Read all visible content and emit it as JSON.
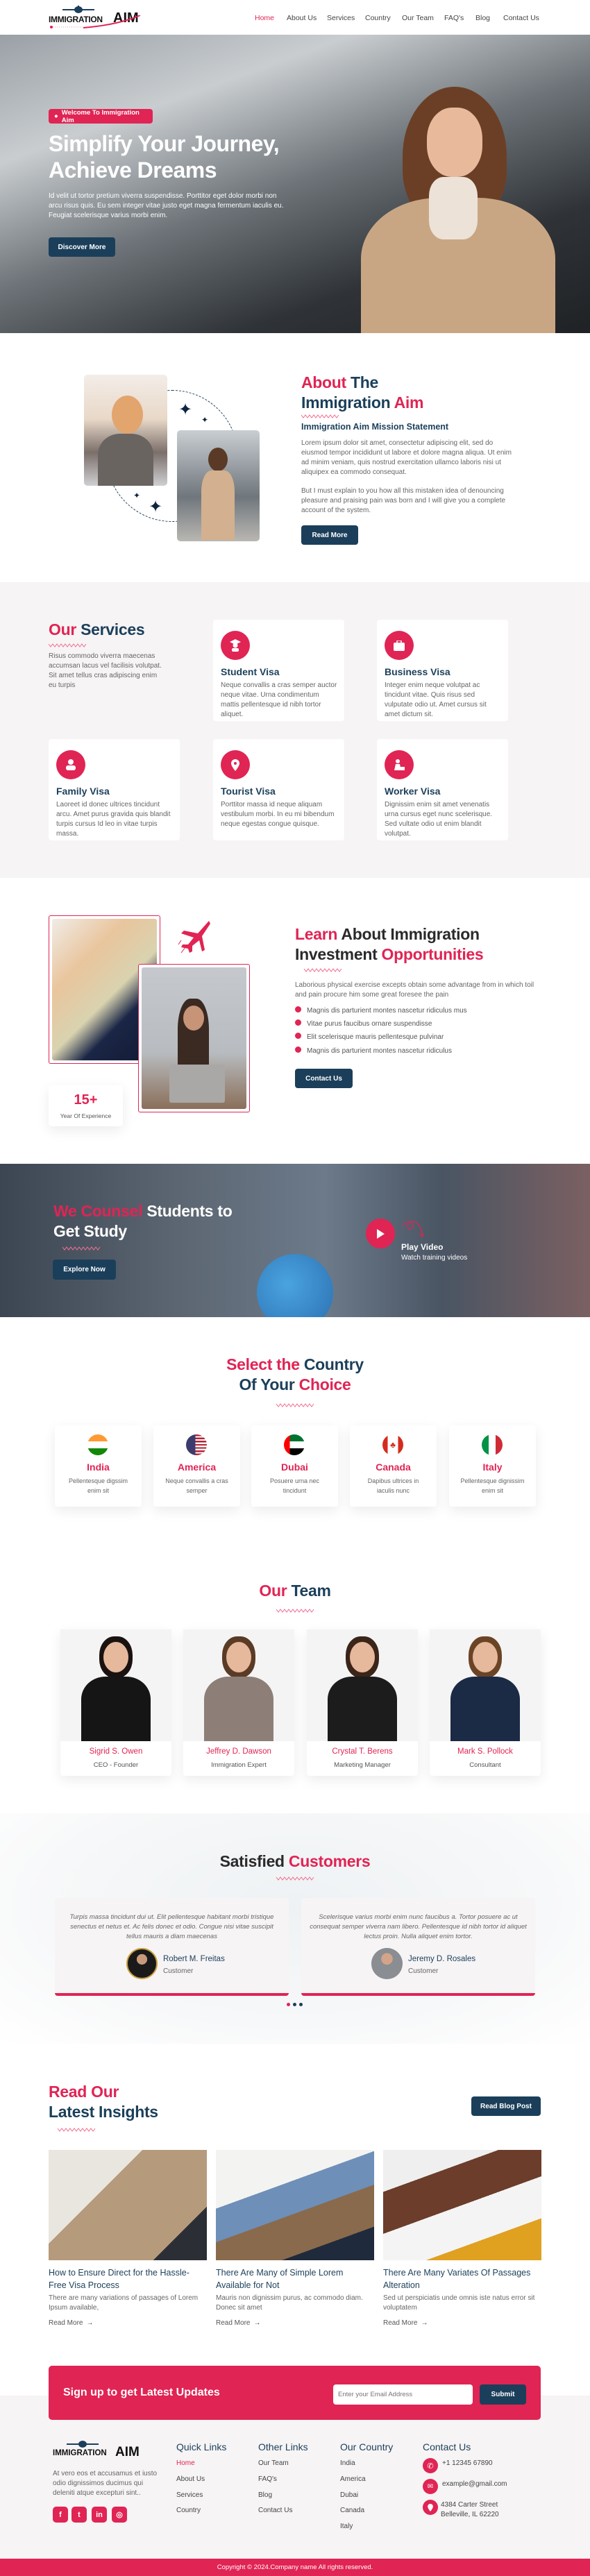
{
  "colors": {
    "accent": "#e02454",
    "primary": "#1b3f5a",
    "section_bg": "#f6f4f5"
  },
  "nav": {
    "logo_text": "IMMIGRATION",
    "logo_accent": "AIM",
    "items": [
      "Home",
      "About Us",
      "Services",
      "Country",
      "Our Team",
      "FAQ's",
      "Blog",
      "Contact Us"
    ],
    "active": "Home"
  },
  "hero": {
    "badge": "Welcome To Immigration Aim",
    "title_line1": "Simplify Your Journey,",
    "title_line2": "Achieve Dreams",
    "paragraph": "Id velit ut tortor pretium viverra suspendisse. Porttitor eget dolor morbi non arcu risus quis. Eu sem integer vitae justo eget magna fermentum iaculis eu. Feugiat scelerisque varius morbi enim.",
    "button": "Discover More"
  },
  "about": {
    "h_accent1": "About",
    "h_1": "The",
    "h_2": "Immigration",
    "h_accent2": "Aim",
    "subtitle": "Immigration Aim Mission Statement",
    "paragraphs": [
      "Lorem ipsum dolor sit amet, consectetur adipiscing elit, sed do eiusmod tempor incididunt ut labore et dolore magna aliqua. Ut enim ad minim veniam, quis nostrud exercitation ullamco laboris nisi ut aliquipex ea commodo consequat.",
      "But I must explain to you how all this mistaken idea of denouncing pleasure and praising pain was born and I will give you a complete account of the system."
    ],
    "button": "Read More"
  },
  "services": {
    "h_accent": "Our",
    "h_rest": "Services",
    "description": "Risus commodo viverra maecenas accumsan lacus vel facilisis volutpat. Sit amet tellus cras adipiscing enim eu turpis",
    "items": [
      {
        "title": "Student Visa",
        "desc": "Neque convallis a cras semper auctor neque vitae. Urna condimentum mattis pellentesque id nibh tortor aliquet.",
        "icon": "graduate-icon"
      },
      {
        "title": "Business Visa",
        "desc": "Integer enim neque volutpat ac tincidunt vitae. Quis risus sed vulputate odio ut. Amet cursus sit amet dictum sit.",
        "icon": "briefcase-icon"
      },
      {
        "title": "Family Visa",
        "desc": "Laoreet id donec ultrices tincidunt arcu. Amet purus gravida quis blandit turpis cursus Id leo in vitae turpis massa.",
        "icon": "user-icon"
      },
      {
        "title": "Tourist Visa",
        "desc": "Porttitor massa id neque aliquam vestibulum morbi. In eu mi bibendum neque egestas congue quisque.",
        "icon": "map-pin-icon"
      },
      {
        "title": "Worker Visa",
        "desc": "Dignissim enim sit amet venenatis urna cursus eget nunc scelerisque. Sed vultate odio ut enim blandit volutpat.",
        "icon": "worker-icon"
      }
    ]
  },
  "learn": {
    "h_accent1": "Learn",
    "h_1": "About Immigration",
    "h_2": "Investment",
    "h_accent2": "Opportunities",
    "paragraph": "Laborious physical exercise excepts obtain some advantage from in which toil and pain procure him some great foresee the pain",
    "list": [
      "Magnis dis parturient montes nascetur ridiculus mus",
      "Vitae purus faucibus ornare suspendisse",
      "Elit scelerisque mauris pellentesque pulvinar",
      "Magnis dis parturient montes nascetur ridiculus"
    ],
    "button": "Contact Us",
    "stat_value": "15+",
    "stat_label": "Year Of Experience"
  },
  "counsel": {
    "h_accent": "We Counsel",
    "h_1": "Students to",
    "h_2": "Get Study",
    "button": "Explore Now",
    "play_title": "Play Video",
    "play_sub": "Watch training videos"
  },
  "countries": {
    "h_accent1": "Select the",
    "h_1": "Country",
    "h_2": "Of Your",
    "h_accent2": "Choice",
    "items": [
      {
        "name": "India",
        "desc": "Pellentesque digssim enim sit"
      },
      {
        "name": "America",
        "desc": "Neque convallis a cras semper"
      },
      {
        "name": "Dubai",
        "desc": "Posuere urna nec tincidunt"
      },
      {
        "name": "Canada",
        "desc": "Dapibus ultrices in iaculis nunc"
      },
      {
        "name": "Italy",
        "desc": "Pellentesque dignissim enim sit"
      }
    ]
  },
  "team": {
    "h_accent": "Our",
    "h_rest": "Team",
    "members": [
      {
        "name": "Sigrid S. Owen",
        "role": "CEO - Founder"
      },
      {
        "name": "Jeffrey D. Dawson",
        "role": "Immigration Expert"
      },
      {
        "name": "Crystal T. Berens",
        "role": "Marketing Manager"
      },
      {
        "name": "Mark S. Pollock",
        "role": "Consultant"
      }
    ]
  },
  "testimonials": {
    "h_1": "Satisfied",
    "h_accent": "Customers",
    "items": [
      {
        "text": "Turpis massa tincidunt dui ut. Elit pellentesque habitant morbi tristique senectus et netus et. Ac felis donec et odio. Congue nisi vitae suscipit tellus mauris a diam maecenas",
        "name": "Robert M. Freitas",
        "role": "Customer"
      },
      {
        "text": "Scelerisque varius morbi enim nunc faucibus a. Tortor posuere ac ut consequat semper viverra nam libero. Pellentesque id nibh tortor id aliquet lectus proin. Nulla aliquet enim tortor.",
        "name": "Jeremy D. Rosales",
        "role": "Customer"
      }
    ]
  },
  "blog": {
    "h_accent": "Read Our",
    "h_rest": "Latest Insights",
    "button": "Read Blog Post",
    "posts": [
      {
        "title": "How to Ensure Direct for the Hassle-Free Visa Process",
        "excerpt": "There are many variations of passages of Lorem Ipsum available,",
        "link": "Read More"
      },
      {
        "title": "There Are Many of Simple Lorem Available for Not",
        "excerpt": "Mauris non dignissim purus, ac commodo diam. Donec sit amet",
        "link": "Read More"
      },
      {
        "title": "There Are Many Variates Of Passages Alteration",
        "excerpt": "Sed ut perspiciatis unde omnis iste natus error sit voluptatem",
        "link": "Read More"
      }
    ]
  },
  "newsletter": {
    "heading": "Sign up to get Latest Updates",
    "placeholder": "Enter your Email Address",
    "submit": "Submit"
  },
  "footer": {
    "about": "At vero eos et accusamus et iusto odio dignissimos ducimus qui deleniti atque excepturi sint..",
    "quick_links": {
      "title": "Quick Links",
      "items": [
        "Home",
        "About Us",
        "Services",
        "Country"
      ]
    },
    "other_links": {
      "title": "Other Links",
      "items": [
        "Our Team",
        "FAQ's",
        "Blog",
        "Contact Us"
      ]
    },
    "our_country": {
      "title": "Our Country",
      "items": [
        "India",
        "America",
        "Dubai",
        "Canada",
        "Italy"
      ]
    },
    "contact": {
      "title": "Contact Us",
      "phone": "+1 12345 67890",
      "email": "example@gmail.com",
      "address": "4384 Carter Street Belleville, IL 62220"
    },
    "copyright": "Copyright © 2024.Company name All rights reserved."
  }
}
